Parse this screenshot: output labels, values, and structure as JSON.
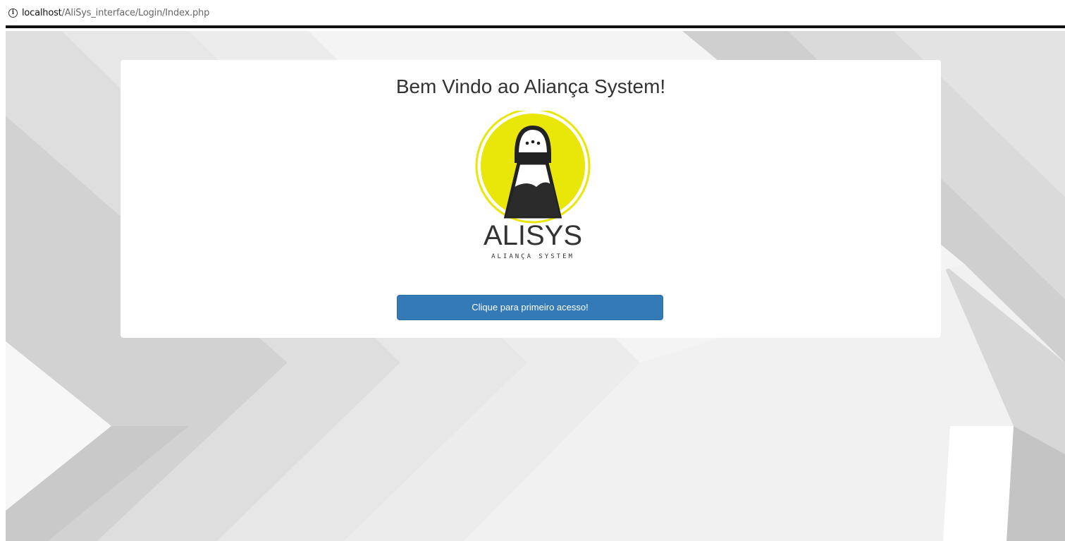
{
  "browser": {
    "url_host": "localhost",
    "url_path": "/AliSys_interface/Login/Index.php"
  },
  "card": {
    "title": "Bem Vindo ao Aliança System!",
    "logo": {
      "wordmark": "ALISYS",
      "tagline": "ALIANÇA SYSTEM",
      "ring_color": "#e9e60a",
      "icon": "salt-shaker-icon"
    },
    "button_label": "Clique para primeiro acesso!"
  },
  "colors": {
    "button_bg": "#337ab7",
    "background": "#f1f1f1"
  }
}
